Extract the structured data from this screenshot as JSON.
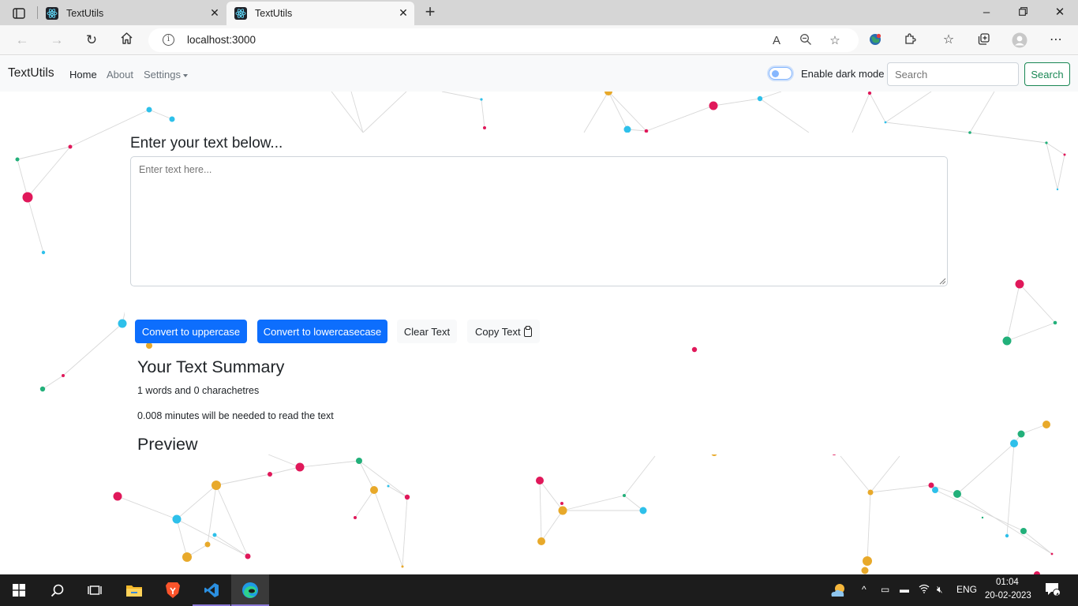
{
  "browser": {
    "tabs": [
      {
        "title": "TextUtils",
        "active": false
      },
      {
        "title": "TextUtils",
        "active": true
      }
    ],
    "url": "localhost:3000"
  },
  "navbar": {
    "brand": "TextUtils",
    "links": {
      "home": "Home",
      "about": "About",
      "settings": "Settings"
    },
    "dark_mode_label": "Enable dark mode",
    "dark_mode_enabled": false,
    "search_placeholder": "Search",
    "search_button": "Search"
  },
  "main": {
    "heading": "Enter your text below...",
    "textarea_placeholder": "Enter text here...",
    "buttons": {
      "uppercase": "Convert to uppercase",
      "lowercase": "Convert to lowercasecase",
      "clear": "Clear Text",
      "copy": "Copy Text"
    },
    "summary_title": "Your Text Summary",
    "summary_words": "1 words and 0 charachetres",
    "summary_minutes": "0.008 minutes will be needed to read the text",
    "preview_title": "Preview"
  },
  "taskbar": {
    "language": "ENG",
    "time": "01:04",
    "date": "20-02-2023",
    "notification_count": "4"
  },
  "colors": {
    "primary": "#0d6efd",
    "success": "#198754",
    "particle_red": "#e0185a",
    "particle_blue": "#2ec0ea",
    "particle_green": "#22b07a",
    "particle_yellow": "#e8a92a"
  }
}
